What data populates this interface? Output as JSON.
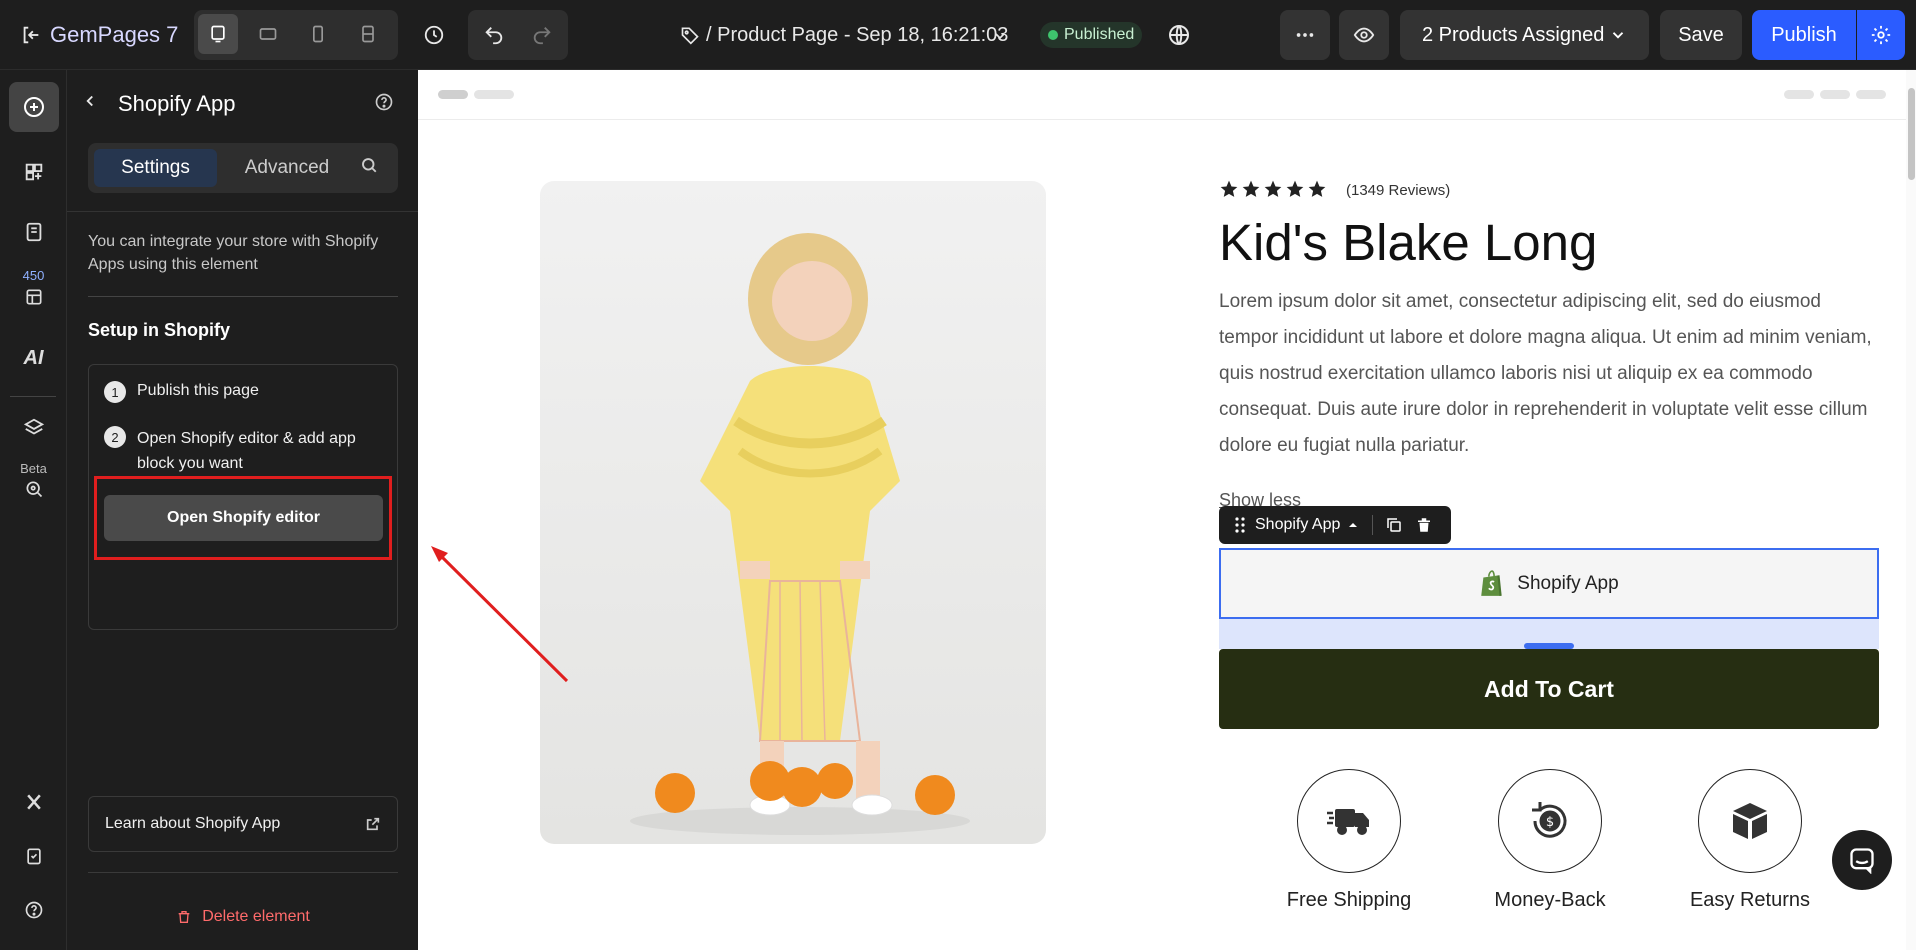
{
  "topbar": {
    "brand": "GemPages 7",
    "page_title": "/ Product Page - Sep 18, 16:21:03",
    "status_badge": "Published",
    "products_assigned": "2 Products Assigned",
    "save_label": "Save",
    "publish_label": "Publish",
    "accent_color": "#2b5cff"
  },
  "leftrail": {
    "badge_count": "450",
    "ai_label": "AI",
    "beta_label": "Beta"
  },
  "panel": {
    "title": "Shopify App",
    "tabs": [
      "Settings",
      "Advanced"
    ],
    "description": "You can integrate your store with Shopify Apps using this element",
    "setup_heading": "Setup in Shopify",
    "steps": [
      {
        "num": "1",
        "text": "Publish this page"
      },
      {
        "num": "2",
        "text": "Open Shopify editor & add app block you want"
      }
    ],
    "open_editor_label": "Open Shopify editor",
    "learn_label": "Learn about Shopify App",
    "delete_label": "Delete element"
  },
  "canvas": {
    "reviews": "(1349 Reviews)",
    "rating_stars": 5,
    "product_title": "Kid's Blake Long",
    "description_lines": [
      "Lorem ipsum dolor sit amet, consectetur adipiscing elit, sed do eiusmod",
      "tempor incididunt ut labore et dolore magna aliqua. Ut enim ad minim veniam,",
      "quis nostrud exercitation ullamco laboris nisi ut aliquip ex ea commodo",
      "consequat. Duis aute irure dolor in reprehenderit in voluptate velit esse cillum",
      "dolore eu fugiat nulla pariatur."
    ],
    "show_less": "Show less",
    "element_toolbar_label": "Shopify App",
    "shopify_block_label": "Shopify App",
    "add_to_cart": "Add To Cart",
    "features": [
      "Free Shipping",
      "Money-Back",
      "Easy Returns"
    ]
  }
}
